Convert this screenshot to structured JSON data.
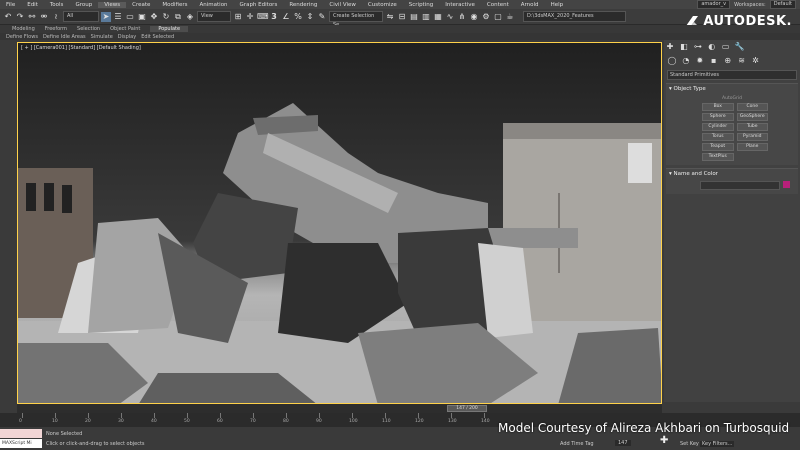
{
  "menu": [
    "File",
    "Edit",
    "Tools",
    "Group",
    "Views",
    "Create",
    "Modifiers",
    "Animation",
    "Graph Editors",
    "Rendering",
    "Civil View",
    "Customize",
    "Scripting",
    "Interactive",
    "Content",
    "Arnold",
    "Help"
  ],
  "user": {
    "name": "amador_v",
    "workspaces_label": "Workspaces:",
    "workspace": "Default",
    "path": "D:\\3dsMAX_2020_Features"
  },
  "brand": "AUTODESK.",
  "toolbar": {
    "filter": "All",
    "view": "View",
    "selection_set": "Create Selection Se"
  },
  "ribbon": {
    "tabs": [
      "Modeling",
      "Freeform",
      "Selection",
      "Object Paint",
      "Populate"
    ],
    "selected": "Populate",
    "sub": [
      "Define Flows",
      "Define Idle Areas",
      "Simulate",
      "Display",
      "Edit Selected"
    ]
  },
  "viewport": {
    "label": "[ + ] [Camera001] [Standard] [Default Shading]"
  },
  "cmdpanel": {
    "dropdown": "Standard Primitives",
    "object_type": "Object Type",
    "autogrid": "AutoGrid",
    "buttons": [
      "Box",
      "Cone",
      "Sphere",
      "GeoSphere",
      "Cylinder",
      "Tube",
      "Torus",
      "Pyramid",
      "Teapot",
      "Plane",
      "TextPlus"
    ],
    "name_and_color": "Name and Color",
    "color": "#b8207a"
  },
  "timeline": {
    "frame": "147 / 200",
    "ticks": [
      "0",
      "10",
      "20",
      "30",
      "40",
      "50",
      "60",
      "70",
      "80",
      "90",
      "100",
      "110",
      "120",
      "130",
      "140"
    ]
  },
  "status": {
    "maxscript": "MAXScript Mi",
    "selection": "None Selected",
    "prompt": "Click or click-and-drag to select objects",
    "add_time_tag": "Add Time Tag",
    "frame": "147",
    "set_key": "Set Key",
    "key_filters": "Key Filters..."
  },
  "credit": "Model Courtesy of Alireza Akhbari on Turbosquid"
}
